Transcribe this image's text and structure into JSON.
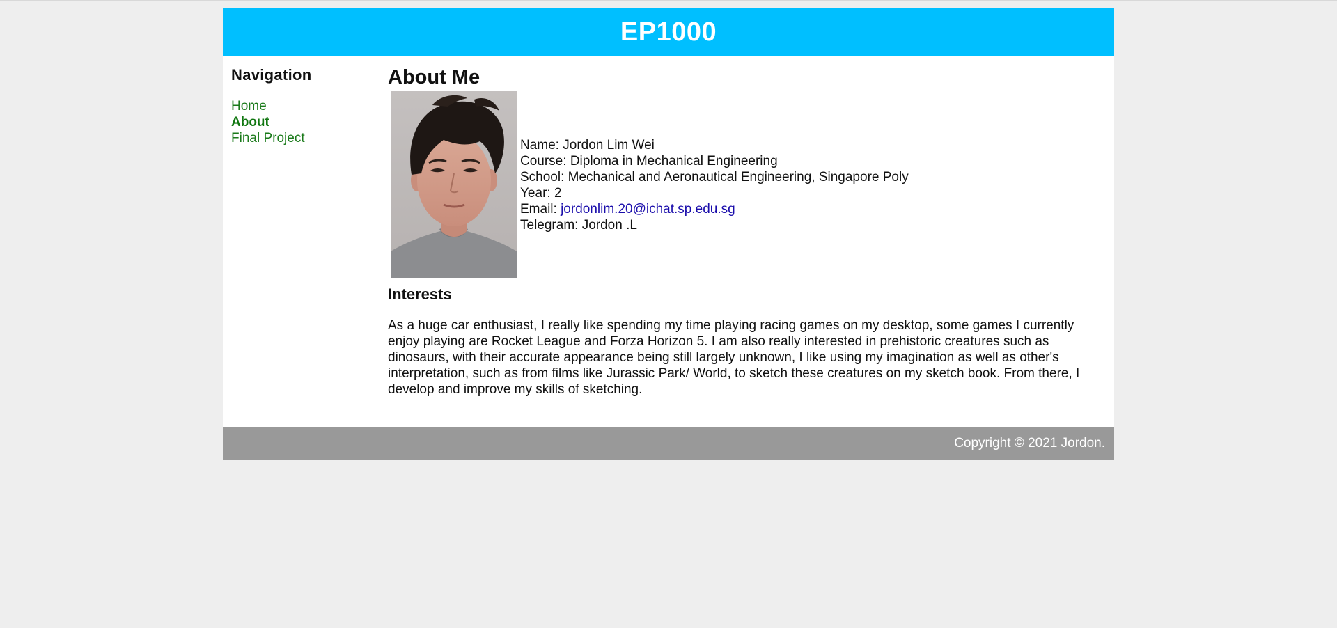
{
  "header": {
    "title": "EP1000",
    "color": "#00bfff"
  },
  "sidebar": {
    "heading": "Navigation",
    "items": [
      {
        "label": "Home",
        "active": false
      },
      {
        "label": "About",
        "active": true
      },
      {
        "label": "Final Project",
        "active": false
      }
    ]
  },
  "main": {
    "title": "About Me",
    "photo_icon": "profile-photo",
    "info": {
      "name_label": "Name: ",
      "name": "Jordon Lim Wei",
      "course_label": "Course: ",
      "course": "Diploma in Mechanical Engineering",
      "school_label": "School: ",
      "school": "Mechanical and Aeronautical Engineering, Singapore Poly",
      "year_label": "Year: ",
      "year": "2",
      "email_label": "Email: ",
      "email": "jordonlim.20@ichat.sp.edu.sg",
      "telegram_label": "Telegram: ",
      "telegram": "Jordon .L"
    },
    "interests_title": "Interests",
    "interests_text": "As a huge car enthusiast, I really like spending my time playing racing games on my desktop, some games I currently enjoy playing are Rocket League and Forza Horizon 5. I am also really interested in prehistoric creatures such as dinosaurs, with their accurate appearance being still largely unknown, I like using my imagination as well as other's interpretation, such as from films like Jurassic Park/ World, to sketch these creatures on my sketch book. From there, I develop and improve my skills of sketching."
  },
  "footer": {
    "copyright": "Copyright © 2021 Jordon.",
    "color": "#999999"
  },
  "colors": {
    "page_background": "#eeeeee",
    "nav_link": "#1a7a1a",
    "email_link": "#1a0dab"
  }
}
